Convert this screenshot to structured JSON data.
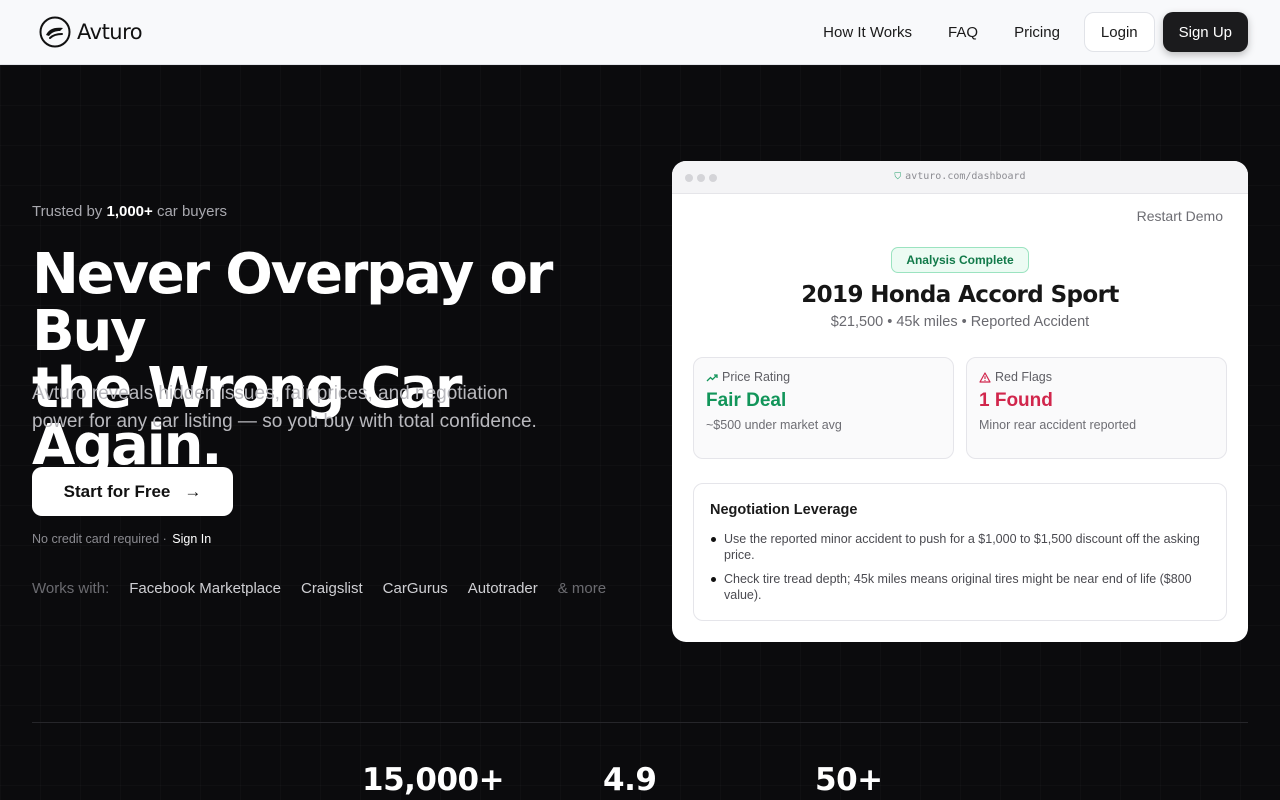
{
  "header": {
    "logo_text": "Avturo",
    "nav": [
      "How It Works",
      "FAQ",
      "Pricing"
    ],
    "login_label": "Login",
    "signup_label": "Sign Up"
  },
  "hero": {
    "trusted_prefix": "Trusted by",
    "trusted_count": "1,000+",
    "trusted_suffix": "car buyers",
    "headline_line1": "Never Overpay or Buy",
    "headline_line2": "the Wrong Car Again.",
    "subheadline": "Avturo reveals hidden issues, fair prices, and negotiation power for any car listing — so you buy with total confidence.",
    "cta_label": "Start for Free",
    "no_cc_text": "No credit card required ·",
    "sign_in_label": "Sign In",
    "works_with_label": "Works with:",
    "works_with": [
      "Facebook Marketplace",
      "Craigslist",
      "CarGurus",
      "Autotrader"
    ],
    "works_more": "& more"
  },
  "demo": {
    "url": "avturo.com/dashboard",
    "restart_label": "Restart Demo",
    "status_badge": "Analysis Complete",
    "car_title": "2019 Honda Accord Sport",
    "car_meta": "$21,500 • 45k miles • Reported Accident",
    "price_rating": {
      "label": "Price Rating",
      "value": "Fair Deal",
      "note": "~$500 under market avg",
      "color": "#12955a"
    },
    "red_flags": {
      "label": "Red Flags",
      "value": "1 Found",
      "note": "Minor rear accident reported",
      "color": "#d1264c"
    },
    "negotiation": {
      "title": "Negotiation Leverage",
      "items": [
        "Use the reported minor accident to push for a $1,000 to $1,500 discount off the asking price.",
        "Check tire tread depth; 45k miles means original tires might be near end of life ($800 value)."
      ]
    }
  },
  "stats": [
    "15,000+",
    "4.9",
    "50+"
  ]
}
